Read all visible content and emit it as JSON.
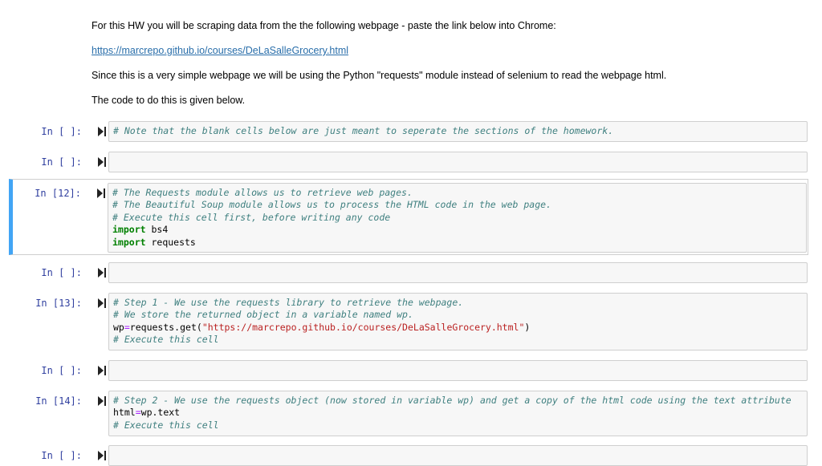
{
  "markdown": {
    "intro": "For this HW you will be scraping data from the the following webpage - paste the link below into Chrome:",
    "link": "https://marcrepo.github.io/courses/DeLaSalleGrocery.html",
    "note": "Since this is a very simple webpage we will be using the Python \"requests\" module instead of selenium to read the webpage html.",
    "code_intro": "The code to do this is given below."
  },
  "cells": [
    {
      "prompt": "In [ ]:",
      "lines": [
        {
          "comment": "# Note that the blank cells below are just meant to seperate the sections of the homework."
        }
      ]
    },
    {
      "prompt": "In [ ]:",
      "lines": []
    },
    {
      "prompt": "In [12]:",
      "selected": true,
      "lines": [
        {
          "comment": "# The Requests module allows us to retrieve web pages."
        },
        {
          "comment": "# The Beautiful Soup module allows us to process the HTML code in the web page."
        },
        {
          "comment": "# Execute this cell first, before writing any code"
        },
        {
          "keyword": "import",
          "rest": " bs4"
        },
        {
          "keyword": "import",
          "rest": " requests"
        }
      ]
    },
    {
      "prompt": "In [ ]:",
      "lines": []
    },
    {
      "prompt": "In [13]:",
      "lines": [
        {
          "comment": "# Step 1 - We use the requests library to retrieve the webpage."
        },
        {
          "comment": "# We store the returned object in a variable named wp."
        },
        {
          "var": "wp",
          "op": "=",
          "call": "requests.get(",
          "string": "\"https://marcrepo.github.io/courses/DeLaSalleGrocery.html\"",
          "close": ")"
        },
        {
          "comment": "# Execute this cell"
        }
      ]
    },
    {
      "prompt": "In [ ]:",
      "lines": []
    },
    {
      "prompt": "In [14]:",
      "lines": [
        {
          "comment": "# Step 2 - We use the requests object (now stored in variable wp) and get a copy of the html code using the text attribute"
        },
        {
          "var": "html",
          "op": "=",
          "call": "wp.text"
        },
        {
          "comment": "# Execute this cell"
        }
      ]
    },
    {
      "prompt": "In [ ]:",
      "lines": []
    }
  ],
  "icons": {
    "run": "run-cell-icon"
  }
}
